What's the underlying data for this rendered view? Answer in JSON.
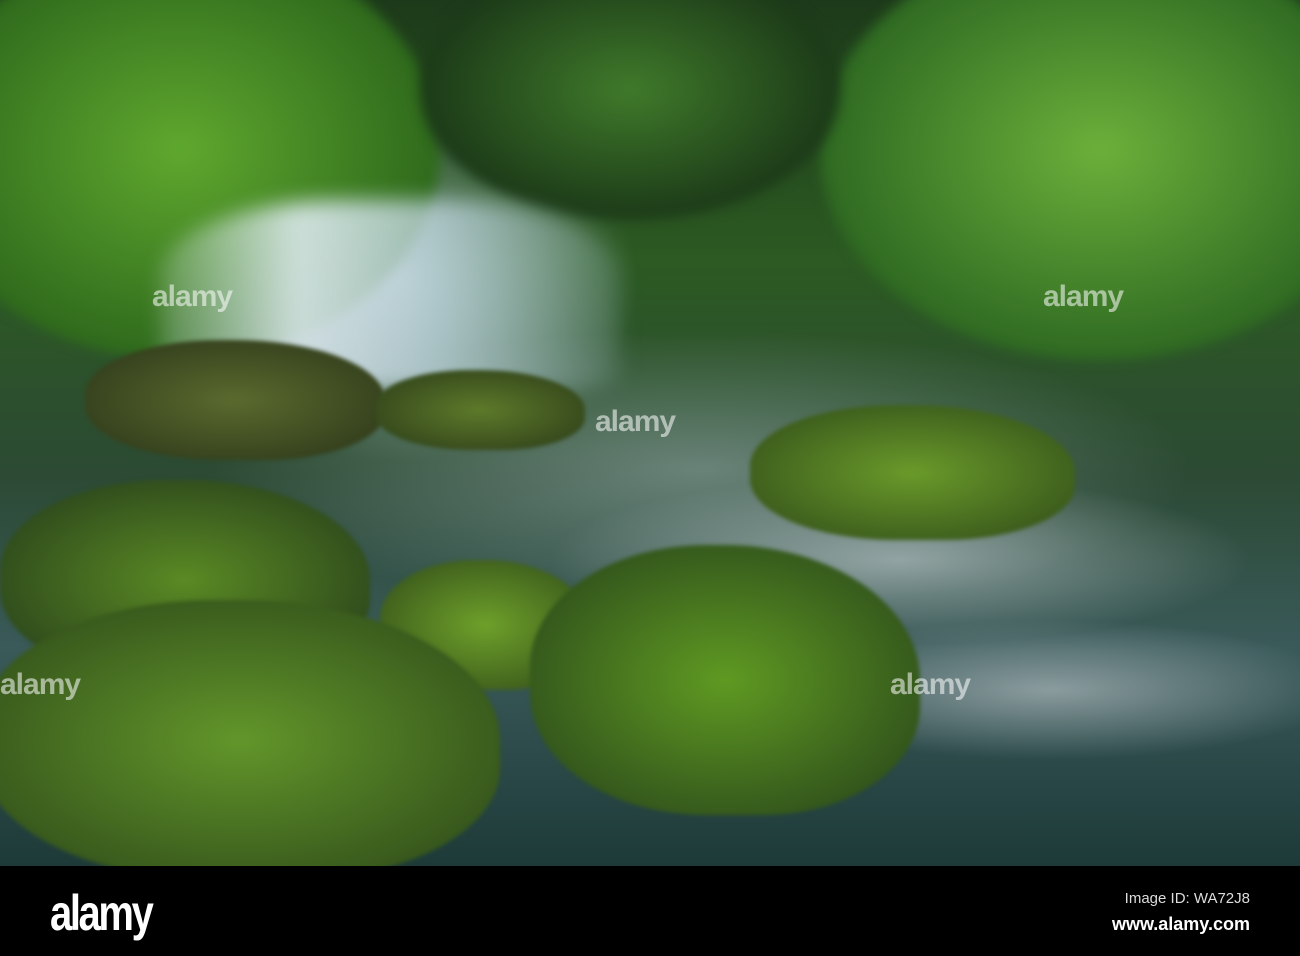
{
  "photo": {
    "subject": "waterfall"
  },
  "watermark": {
    "text": "alamy"
  },
  "footer": {
    "logo": "alamy",
    "image_id": "Image ID: WA72J8",
    "website": "www.alamy.com"
  }
}
